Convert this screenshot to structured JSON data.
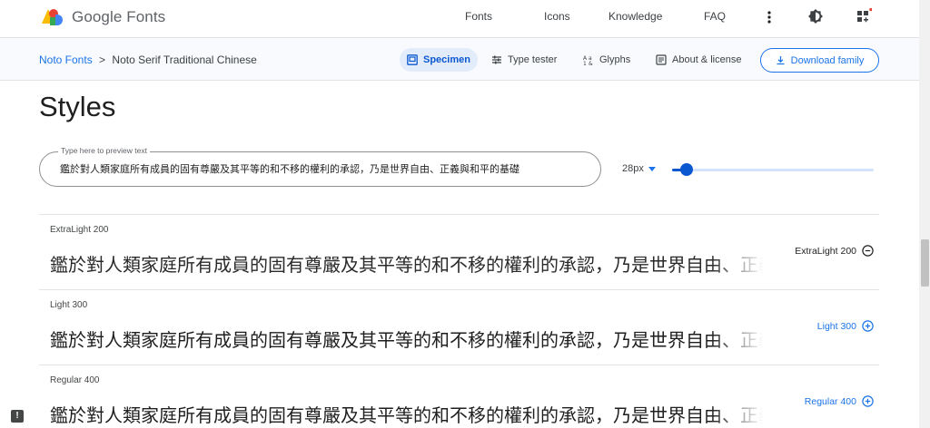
{
  "header": {
    "logo_text": "Google Fonts",
    "nav": [
      {
        "label": "Fonts"
      },
      {
        "label": "Icons"
      },
      {
        "label": "Knowledge"
      },
      {
        "label": "FAQ"
      }
    ],
    "more_icon": "more-vert-icon",
    "theme_icon": "theme-toggle-icon",
    "apps_icon": "apps-grid-icon",
    "notification_dot_color": "#ea4335"
  },
  "subbar": {
    "breadcrumb": {
      "root": "Noto Fonts",
      "separator": ">",
      "current": "Noto Serif Traditional Chinese"
    },
    "tabs": [
      {
        "label": "Specimen",
        "icon": "specimen-icon",
        "active": true
      },
      {
        "label": "Type tester",
        "icon": "tune-icon",
        "active": false
      },
      {
        "label": "Glyphs",
        "icon": "glyphs-icon",
        "active": false
      },
      {
        "label": "About & license",
        "icon": "article-icon",
        "active": false
      }
    ],
    "download_label": "Download family",
    "download_icon": "download-icon"
  },
  "main": {
    "title": "Styles",
    "preview": {
      "label": "Type here to preview text",
      "value": "鑑於對人類家庭所有成員的固有尊嚴及其平等的和不移的權利的承認，乃是世界自由、正義與和平的基礎"
    },
    "size": {
      "value": "28px",
      "slider_fraction": 0.07
    },
    "styles": [
      {
        "name": "ExtraLight 200",
        "sample": "鑑於對人類家庭所有成員的固有尊嚴及其平等的和不移的權利的承認，乃是世界自由、正義與和平的基礎",
        "action_label": "ExtraLight 200",
        "action_icon": "remove-circle-icon",
        "selected": true
      },
      {
        "name": "Light 300",
        "sample": "鑑於對人類家庭所有成員的固有尊嚴及其平等的和不移的權利的承認，乃是世界自由、正義與和平的基礎",
        "action_label": "Light 300",
        "action_icon": "add-circle-icon",
        "selected": false
      },
      {
        "name": "Regular 400",
        "sample": "鑑於對人類家庭所有成員的固有尊嚴及其平等的和不移的權利的承認，乃是世界自由、正義與和平的基礎",
        "action_label": "Regular 400",
        "action_icon": "add-circle-icon",
        "selected": false
      }
    ]
  },
  "colors": {
    "accent": "#1a73e8",
    "active_tab_bg": "#e3ecfb",
    "subbar_bg": "#f8fafd"
  },
  "feedback_icon": "feedback-icon"
}
